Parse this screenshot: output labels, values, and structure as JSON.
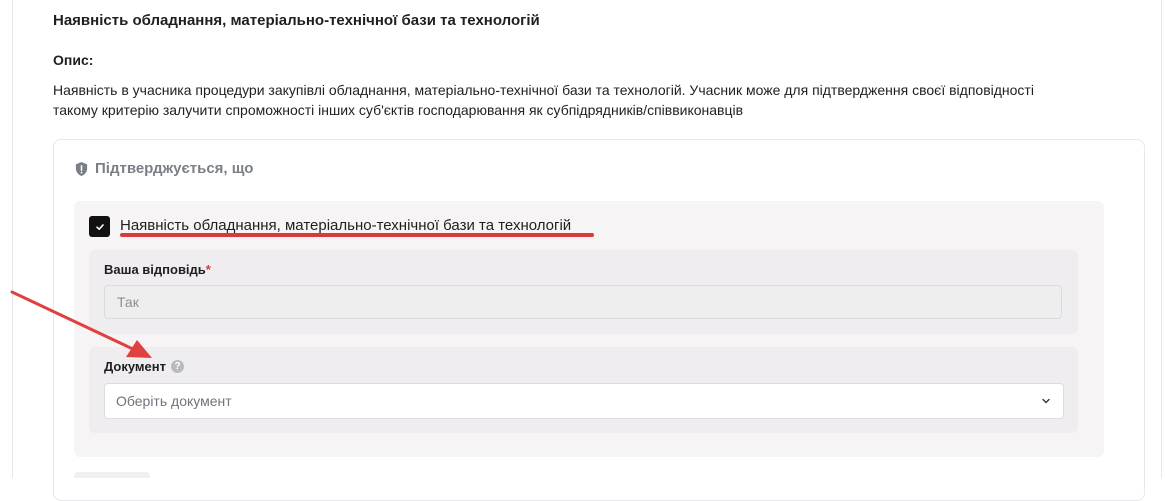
{
  "section": {
    "title": "Наявність обладнання, матеріально-технічної бази та технологій",
    "description_label": "Опис:",
    "description_line1": "Наявність в учасника процедури закупівлі обладнання, матеріально-технічної бази та технологій. Учасник може для підтвердження своєї відповідності",
    "description_line2": "такому критерію залучити спроможності інших суб'єктів господарювання як субпідрядників/співвиконавців"
  },
  "confirmation": {
    "header": "Підтверджується, що",
    "requirement": {
      "label": "Наявність обладнання, матеріально-технічної бази та технологій",
      "checked": true
    },
    "answer": {
      "label": "Ваша відповідь",
      "required_mark": "*",
      "value": "Так"
    },
    "document": {
      "label": "Документ",
      "help_icon": "?",
      "placeholder": "Оберіть документ"
    }
  },
  "annotations": {
    "underline_color": "#d93a3a",
    "arrow_color": "#e04040"
  }
}
